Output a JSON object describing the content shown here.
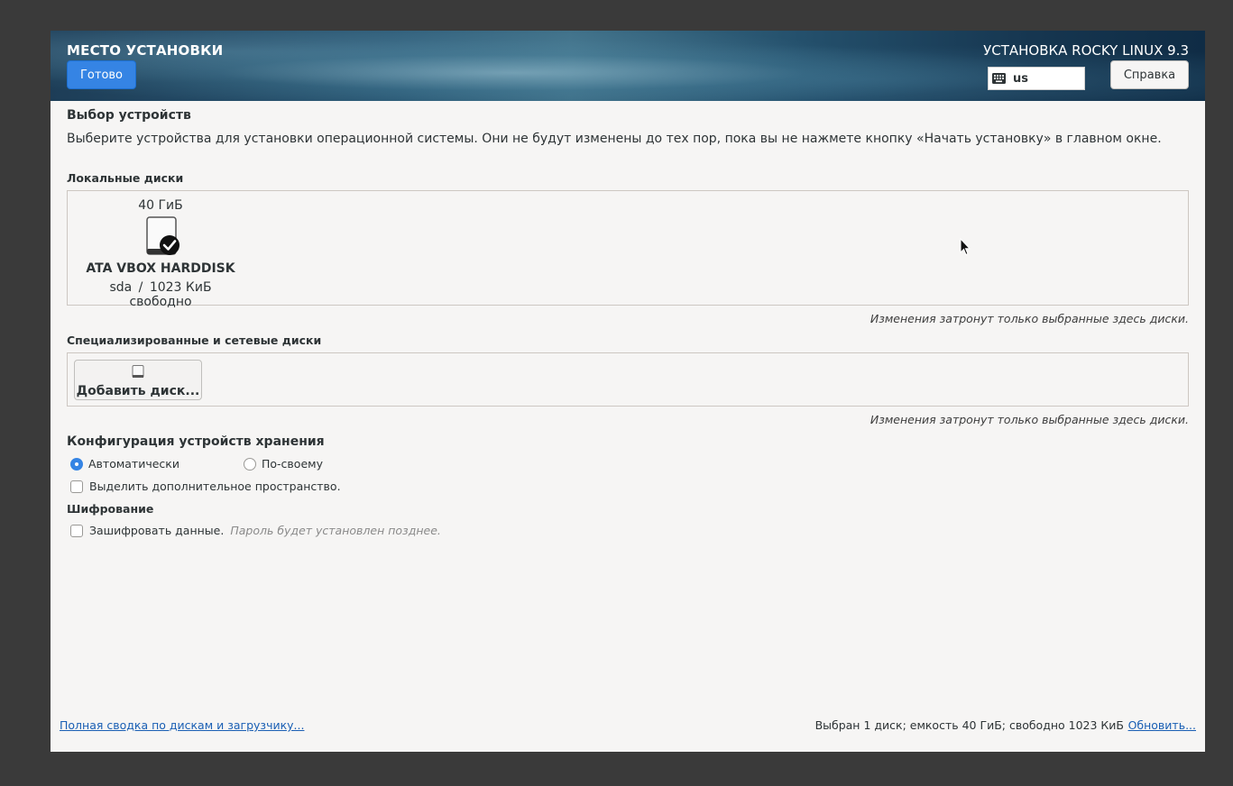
{
  "header": {
    "title": "МЕСТО УСТАНОВКИ",
    "done_label": "Готово",
    "product": "УСТАНОВКА ROCKY LINUX 9.3",
    "keyboard_layout": "us",
    "help_label": "Справка"
  },
  "device_selection": {
    "title": "Выбор устройств",
    "description": "Выберите устройства для установки операционной системы. Они не будут изменены до тех пор, пока вы не нажмете кнопку «Начать установку» в главном окне."
  },
  "local_disks": {
    "title": "Локальные диски",
    "disks": [
      {
        "size": "40 ГиБ",
        "name": "ATA VBOX HARDDISK",
        "device": "sda",
        "separator": "/",
        "free": "1023 КиБ свободно",
        "selected": true
      }
    ],
    "note": "Изменения затронут только выбранные здесь диски."
  },
  "specialized_disks": {
    "title": "Специализированные и сетевые диски",
    "add_label": "Добавить диск...",
    "note": "Изменения затронут только выбранные здесь диски."
  },
  "storage_config": {
    "title": "Конфигурация устройств хранения",
    "auto_label": "Автоматически",
    "custom_label": "По-своему",
    "selected": "auto",
    "reclaim_label": "Выделить дополнительное пространство."
  },
  "encryption": {
    "title": "Шифрование",
    "encrypt_label": "Зашифровать данные.",
    "hint": "Пароль будет установлен позднее."
  },
  "footer": {
    "summary_link": "Полная сводка по дискам и загрузчику...",
    "status": "Выбран 1 диск; емкость 40 ГиБ; свободно 1023 КиБ",
    "refresh_link": "Обновить..."
  },
  "colors": {
    "accent": "#3584e4",
    "link": "#1a5fb4",
    "background": "#f6f5f4"
  }
}
